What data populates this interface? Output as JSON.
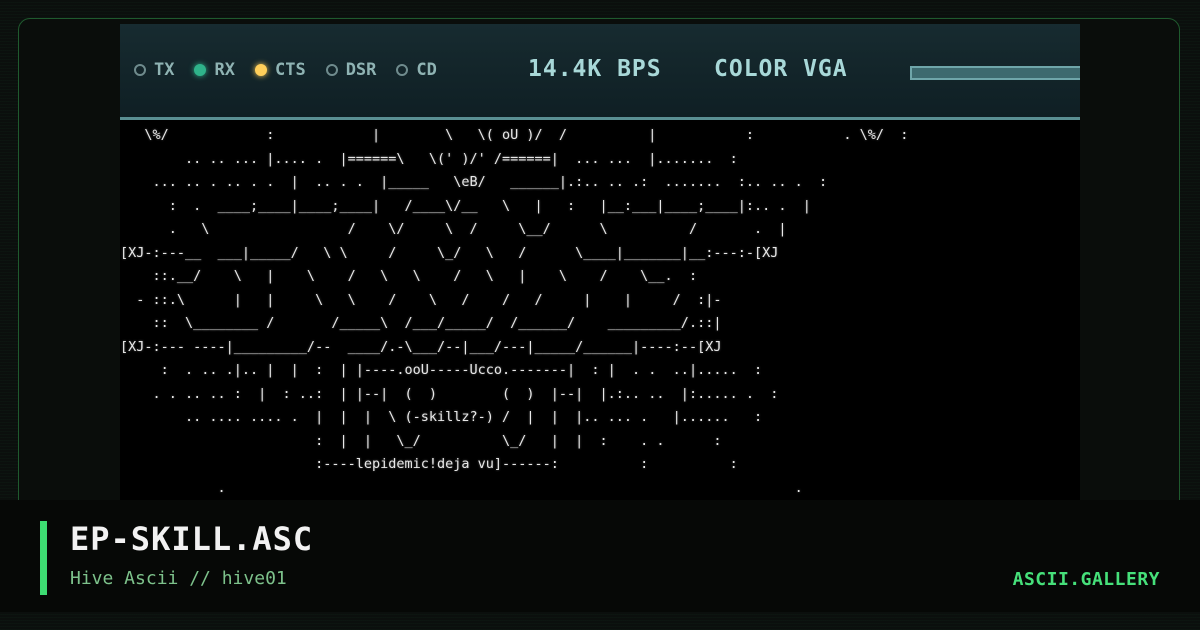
{
  "status_bar": {
    "indicators": [
      {
        "label": "TX",
        "state": "off",
        "color": "#6f8b8d"
      },
      {
        "label": "RX",
        "state": "on",
        "color": "#2fb38a"
      },
      {
        "label": "CTS",
        "state": "on",
        "color": "#ffcf5a"
      },
      {
        "label": "DSR",
        "state": "off",
        "color": "#6f8b8d"
      },
      {
        "label": "CD",
        "state": "off",
        "color": "#6f8b8d"
      }
    ],
    "baud_rate": "14.4K BPS",
    "display_mode": "COLOR VGA",
    "progress": 1.0
  },
  "artwork": {
    "lines": [
      "   \\%/            :            |        \\   \\( oU )/  /          |           :           . \\%/  :",
      "        .. .. ... |.... .  |======\\   \\(' )/' /======|  ... ...  |.......  :",
      "    ... .. . .. . .  |  .. . .  |_____   \\eB/   ______|.:.. .. .:  .......  :.. .. .  :",
      "      :  .  ____;____|____;____|   /____\\/__   \\   |   :   |__:___|____;____|:.. .  |",
      "      .   \\                 /    \\/     \\  /     \\__/      \\          /       .  |",
      "[XJ-:---__  ___|_____/   \\ \\     /     \\_/   \\   /      \\____|_______|__:---:-[XJ",
      "    ::.__/    \\   |    \\    /   \\   \\    /   \\   |    \\    /    \\__.  :",
      "  - ::.\\      |   |     \\   \\    /    \\   /    /   /     |    |     /  :|-",
      "    ::  \\________ /       /_____\\  /___/_____/  /______/    _________/.::|",
      "[XJ-:--- ----|_________/--  ____/.-\\___/--|___/---|_____/______|----:--[XJ",
      "     :  . .. .|.. |  |  :  | |----.ooU-----Ucco.-------|  : |  . .  ..|.....  :",
      "    . . .. .. :  |  : ..:  | |--|  (  )        (  )  |--|  |.:.. ..  |:..... .  :",
      "        .. .... .... .  |  |  |  \\ (-skillz?-) /  |  |  |.. ... .   |......   :",
      "                        :  |  |   \\_/          \\_/   |  |  :    . .      :",
      "                        :----lepidemic!deja vu]------:          :          :",
      "            .                                                                      ."
    ]
  },
  "footer": {
    "title": "EP-SKILL.ASC",
    "subtitle": "Hive Ascii // hive01",
    "brand": "ASCII.GALLERY",
    "accent_color": "#3ddc72"
  }
}
